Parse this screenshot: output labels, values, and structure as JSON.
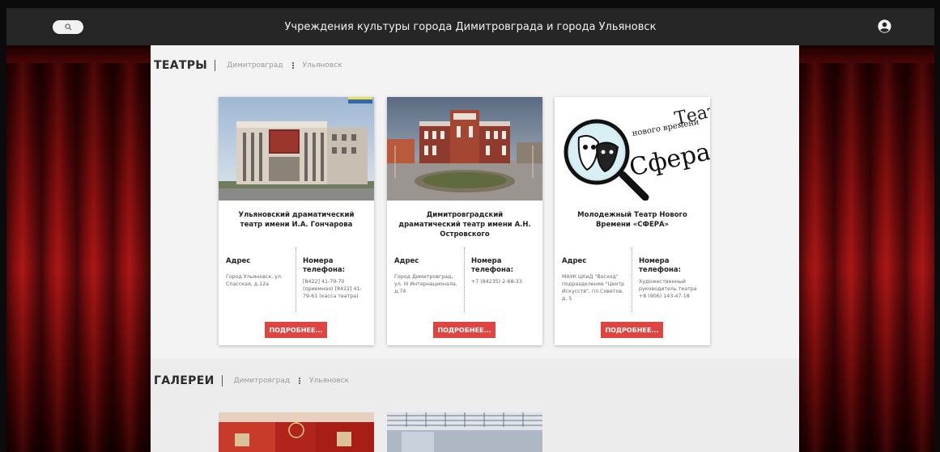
{
  "header": {
    "title": "Учреждения культуры города Димитровграда и города Ульяновск"
  },
  "theaters": {
    "title": "ТЕАТРЫ",
    "city1": "Димитровград",
    "city2": "Ульяновск",
    "cards": [
      {
        "title": "Ульяновский драматический театр имени И.А. Гончарова",
        "address_label": "Адрес",
        "address": "Город Ульяновск, ул. Спасская, д.12а",
        "phone_label": "Номера телефона:",
        "phones": "[8422] 41-79-70 (приемная) [8422] 41-79-61 (касса театра)",
        "button": "ПОДРОБНЕЕ..."
      },
      {
        "title": "Димитровградский драматический театр имени А.Н. Островского",
        "address_label": "Адрес",
        "address": "Город Димитровград, ул. III Интернационала, д.74",
        "phone_label": "Номера телефона:",
        "phones": "+7 (84235) 2-68-33",
        "button": "ПОДРОБНЕЕ..."
      },
      {
        "title": "Молодежный Театр Нового Времени «СФЕРА»",
        "address_label": "Адрес",
        "address": "МАУК ЦКиД \"Восход\" подразделение \"Центр Искусств\", пл.Советов, д. 5",
        "phone_label": "Номера телефона:",
        "phones": "Художественный руководитель театра +8 (906) 143-47-18",
        "button": "ПОДРОБНЕЕ..."
      }
    ],
    "logo_text": {
      "line1": "Театр",
      "line2": "нового времени",
      "line3": "Сфера"
    }
  },
  "galleries": {
    "title": "ГАЛЕРЕИ",
    "city1": "Димитровград",
    "city2": "Ульяновск"
  },
  "icons": {
    "search": "search-icon",
    "user": "user-circle-icon"
  },
  "colors": {
    "topbar": "#262626",
    "accent": "#e0443e",
    "curtain": "#8b0d0d"
  }
}
